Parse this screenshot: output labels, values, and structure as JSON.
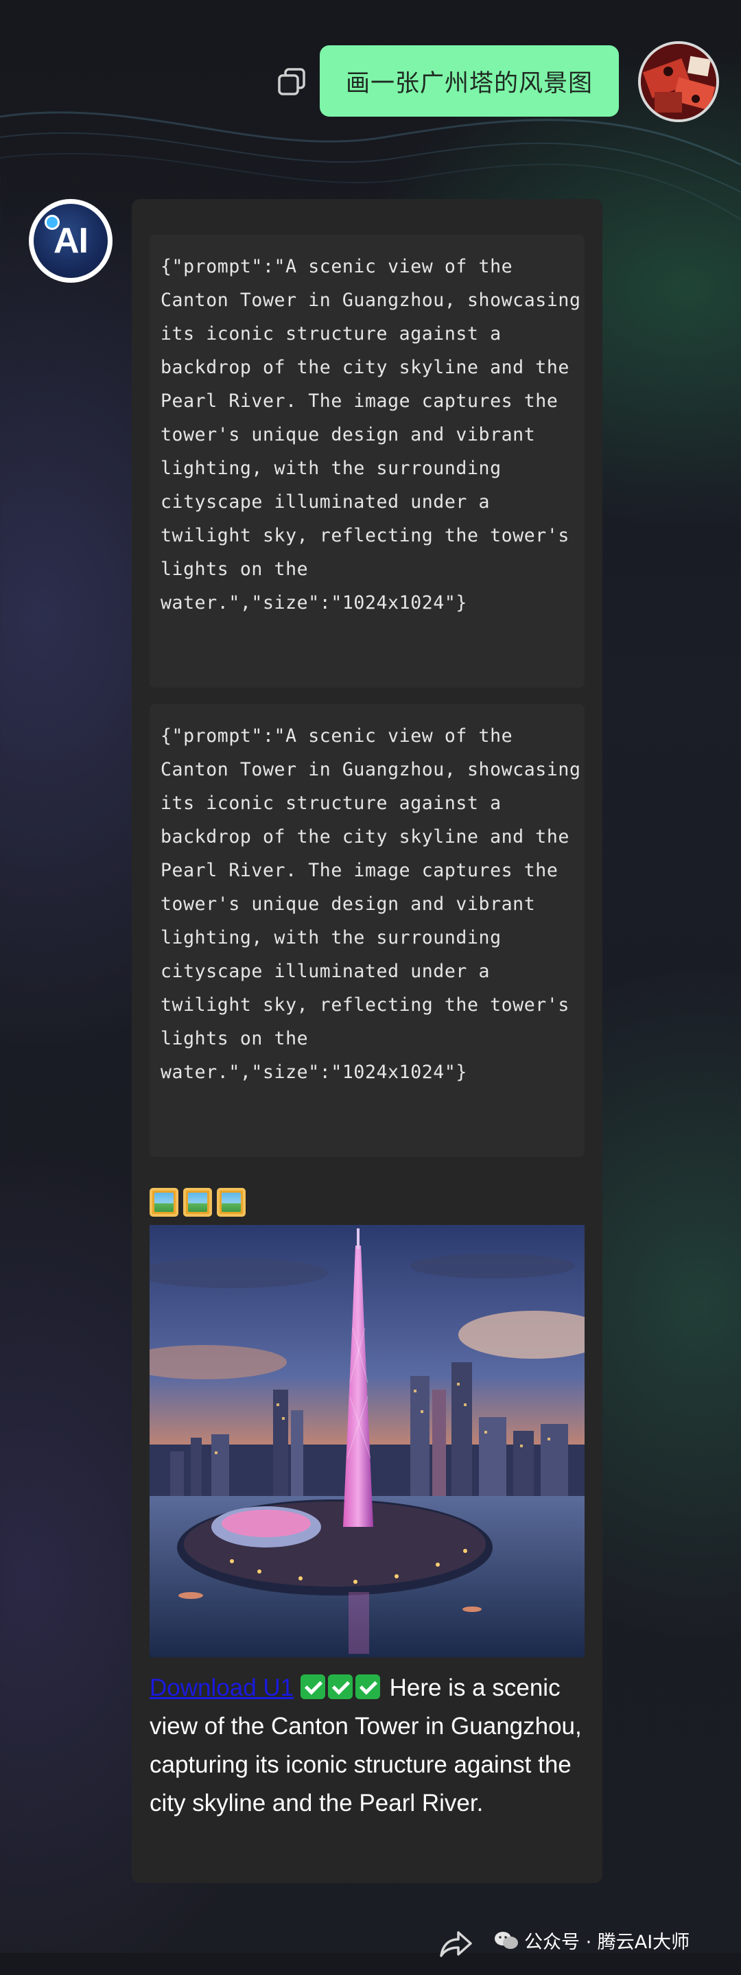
{
  "user_message": {
    "text": "画一张广州塔的风景图"
  },
  "assistant": {
    "avatar_label": "AI",
    "tool_calls": [
      {
        "text": "{\"prompt\":\"A scenic view of the Canton Tower in Guangzhou, showcasing its iconic structure against a backdrop of the city skyline and the Pearl River. The image captures the tower's unique design and vibrant lighting, with the surrounding cityscape illuminated under a twilight sky, reflecting the tower's lights on the water.\",\"size\":\"1024x1024\"}"
      },
      {
        "text": "{\"prompt\":\"A scenic view of the Canton Tower in Guangzhou, showcasing its iconic structure against a backdrop of the city skyline and the Pearl River. The image captures the tower's unique design and vibrant lighting, with the surrounding cityscape illuminated under a twilight sky, reflecting the tower's lights on the water.\",\"size\":\"1024x1024\"}"
      }
    ],
    "image_emoji_count": 3,
    "download_label": "Download U1",
    "check_count": 3,
    "reply_text": "Here is a scenic view of the Canton Tower in Guangzhou, capturing its iconic structure against the city skyline and the Pearl River."
  },
  "watermark": {
    "text": "公众号 · 腾云AI大师"
  },
  "icons": {
    "copy": "copy-icon",
    "share": "share-icon",
    "image_emoji": "framed-picture-icon",
    "check": "check-mark-icon",
    "wechat": "wechat-icon"
  },
  "colors": {
    "user_bubble": "#7ef5a8",
    "assistant_bubble": "#262626",
    "code_background": "#2c2c2c",
    "link": "#1a1ae0",
    "check": "#25b347"
  }
}
